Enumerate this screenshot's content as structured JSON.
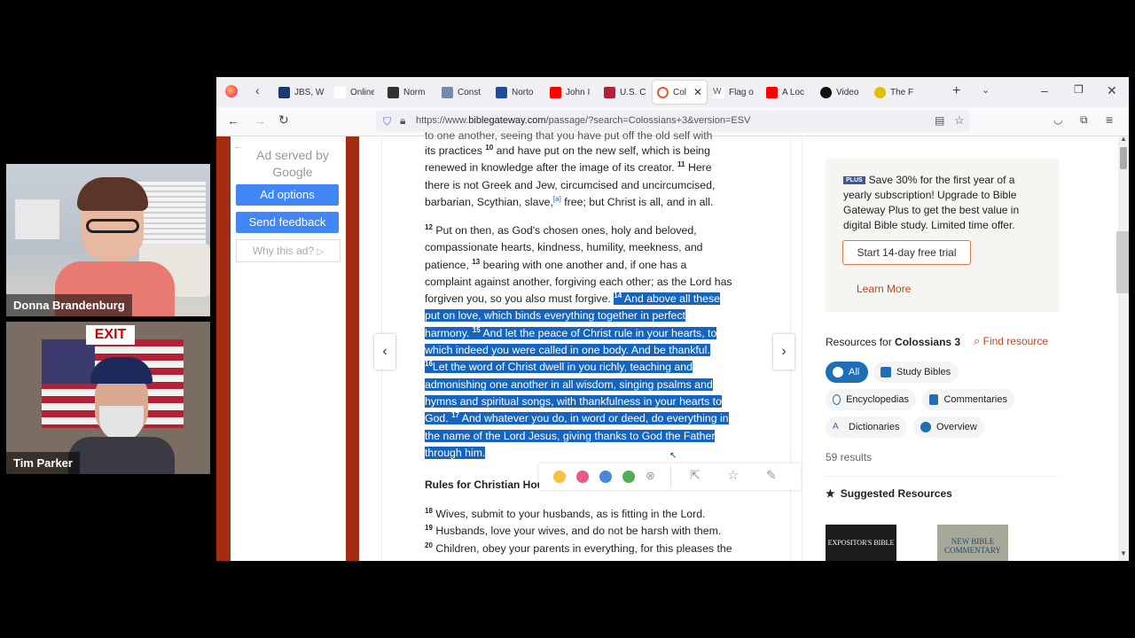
{
  "participants": [
    {
      "name": "Donna Brandenburg"
    },
    {
      "name": "Tim Parker"
    }
  ],
  "tabs": [
    {
      "label": "JBS, W",
      "color": "#1b3a6b"
    },
    {
      "label": "Online",
      "color": "#aaaaaa"
    },
    {
      "label": "Norm",
      "color": "#333333"
    },
    {
      "label": "Const",
      "color": "#7788aa"
    },
    {
      "label": "Norto",
      "color": "#1e4b9b"
    },
    {
      "label": "John I",
      "color": "#ff0000"
    },
    {
      "label": "U.S. C",
      "color": "#b22234"
    },
    {
      "label": "Col",
      "color": "#e85d2c"
    },
    {
      "label": "Flag o",
      "color": "#555555"
    },
    {
      "label": "A Loc",
      "color": "#ff0000"
    },
    {
      "label": "Video",
      "color": "#111111"
    },
    {
      "label": "The F",
      "color": "#e0c000"
    }
  ],
  "url": {
    "prefix": "https://www.",
    "domain": "biblegateway.com",
    "path": "/passage/?search=Colossians+3&version=ESV"
  },
  "ad": {
    "title": "Ad served by Google",
    "options": "Ad options",
    "feedback": "Send feedback",
    "why": "Why this ad?"
  },
  "bible": {
    "p1": {
      "cut": "to one another, seeing that you have put off the old self  with",
      "l1": "its practices",
      "v10": "10",
      "l1b": "and have put on the new self, which is being",
      "l2": "renewed in knowledge after the image of its creator.",
      "v11": "11",
      "l2b": "Here",
      "l3": "there is not Greek and Jew, circumcised and uncircumcised,",
      "l4": "barbarian, Scythian, slave,",
      "fn": "[a]",
      "l4b": "free; but Christ is all, and in all."
    },
    "p2": {
      "v12": "12",
      "l1": "Put on then, as God's chosen ones, holy and beloved,",
      "l2": "compassionate hearts, kindness, humility, meekness, and",
      "l3": "patience,",
      "v13": "13",
      "l3b": "bearing with one another and, if one has a",
      "l4": "complaint against another, forgiving each other; as the Lord has",
      "l5": "forgiven you, so you also must forgive.",
      "v14": "14",
      "s1": "And above all these",
      "s2": "put on love, which binds everything together in perfect",
      "s3": "harmony.",
      "v15": "15",
      "s3b": "And let the peace of Christ rule in your hearts, to",
      "s4": "which indeed you were called in one body. And be thankful.",
      "v16": "16",
      "s5": "Let the word of Christ dwell in you richly, teaching and",
      "s6": "admonishing one another in all wisdom, singing psalms and",
      "s7": "hymns and spiritual songs, with thankfulness in your hearts to",
      "s8": "God.",
      "v17": "17",
      "s8b": "And whatever you do, in word or deed, do everything in",
      "s9": "the name of the Lord Jesus, giving thanks to God the Father",
      "s10": "through him."
    },
    "heading": "Rules for Christian Hou",
    "p3": {
      "v18": "18",
      "l1": "Wives, submit to your husbands, as is fitting in the Lord.",
      "v19": "19",
      "l2": "Husbands, love your wives, and do not be harsh with them.",
      "v20": "20",
      "l3": "Children, obey your parents in everything, for this pleases the"
    }
  },
  "right": {
    "plus_badge": "PLUS",
    "promo": "Save 30% for the first year of a yearly subscription! Upgrade to Bible Gateway Plus to get the best value in digital Bible study. Limited time offer.",
    "trial": "Start 14-day free trial",
    "learn": "Learn More",
    "resources_prefix": "Resources for",
    "resources_book": "Colossians 3",
    "find": "Find resource",
    "chips": {
      "all": "All",
      "study": "Study Bibles",
      "ency": "Encyclopedias",
      "comm": "Commentaries",
      "dict": "Dictionaries",
      "over": "Overview"
    },
    "results": "59 results",
    "suggested": "Suggested Resources",
    "book1": "EXPOSITOR'S BIBLE",
    "book2": "NEW BIBLE COMMENTARY"
  },
  "highlight_colors": [
    "#f5c242",
    "#e8588a",
    "#4a87d6",
    "#4caf50"
  ]
}
